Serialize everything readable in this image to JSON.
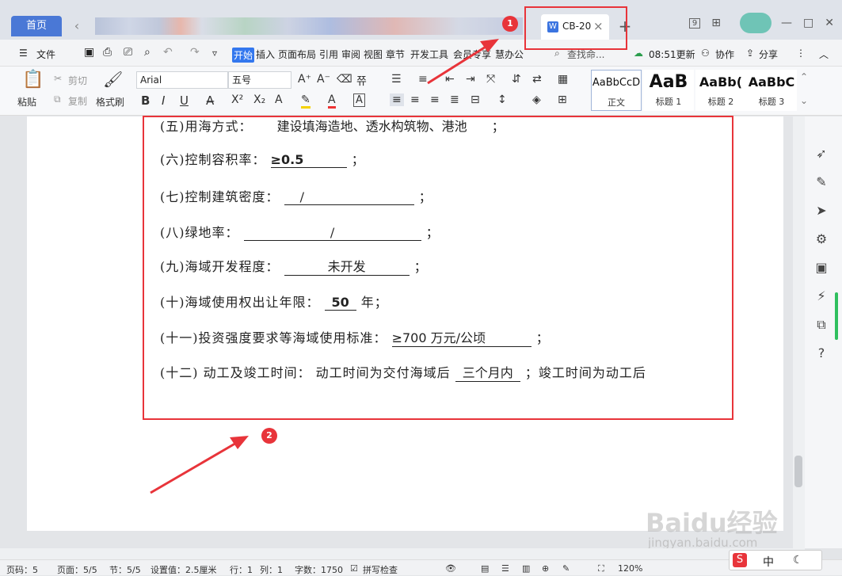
{
  "titlebar": {
    "home_label": "首页",
    "doc_tab_label": "CB-20",
    "win_buttons": [
      "9",
      "⊞",
      "—",
      "□",
      "✕"
    ]
  },
  "menu": {
    "file": "文件",
    "items": [
      "开始",
      "插入",
      "页面布局",
      "引用",
      "审阅",
      "视图",
      "章节",
      "开发工具",
      "会员专享",
      "慧办公"
    ],
    "search": "查找命...",
    "update": "08:51更新",
    "collab": "协作",
    "share": "分享"
  },
  "toolbar": {
    "paste": "粘贴",
    "cut": "剪切",
    "copy": "复制",
    "format_painter": "格式刷",
    "font_name": "Arial",
    "font_size": "五号",
    "styles": [
      {
        "preview": "AaBbCcD",
        "name": "正文"
      },
      {
        "preview": "AaB",
        "name": "标题 1"
      },
      {
        "preview": "AaBb(",
        "name": "标题 2"
      },
      {
        "preview": "AaBbC",
        "name": "标题 3"
      }
    ]
  },
  "document": {
    "l5_label": "(五)用海方式：",
    "l5_value": "建设填海造地、透水构筑物、港池",
    "l5_end": "；",
    "l6_label": "(六)控制容积率：",
    "l6_value": "≥0.5",
    "l6_end": "；",
    "l7_label": "(七)控制建筑密度：",
    "l7_value": "/",
    "l7_end": "；",
    "l8_label": "(八)绿地率：",
    "l8_value": "/",
    "l8_end": "；",
    "l9_label": "(九)海域开发程度：",
    "l9_value": "未开发",
    "l9_end": "；",
    "l10_label": "(十)海域使用权出让年限：",
    "l10_value": "50",
    "l10_end": "年；",
    "l11_label": "(十一)投资强度要求等海域使用标准：",
    "l11_value": "≥700 万元/公顷",
    "l11_end": "；",
    "l12_label": "(十二) 动工及竣工时间：",
    "l12_mid": "动工时间为交付海域后",
    "l12_value": "三个月内",
    "l12_end": "；竣工时间为动工后"
  },
  "status": {
    "page_code": "页码：5",
    "pages": "页面：5/5",
    "section": "节：5/5",
    "setting": "设置值：2.5厘米",
    "row": "行：1",
    "col": "列：1",
    "words": "字数：1750",
    "spell": "拼写检查",
    "zoom": "120%"
  },
  "annotations": {
    "badge1": "1",
    "badge2": "2",
    "color": "#e8343a"
  },
  "watermark": {
    "text": "Baidu经验",
    "url": "jingyan.baidu.com"
  }
}
